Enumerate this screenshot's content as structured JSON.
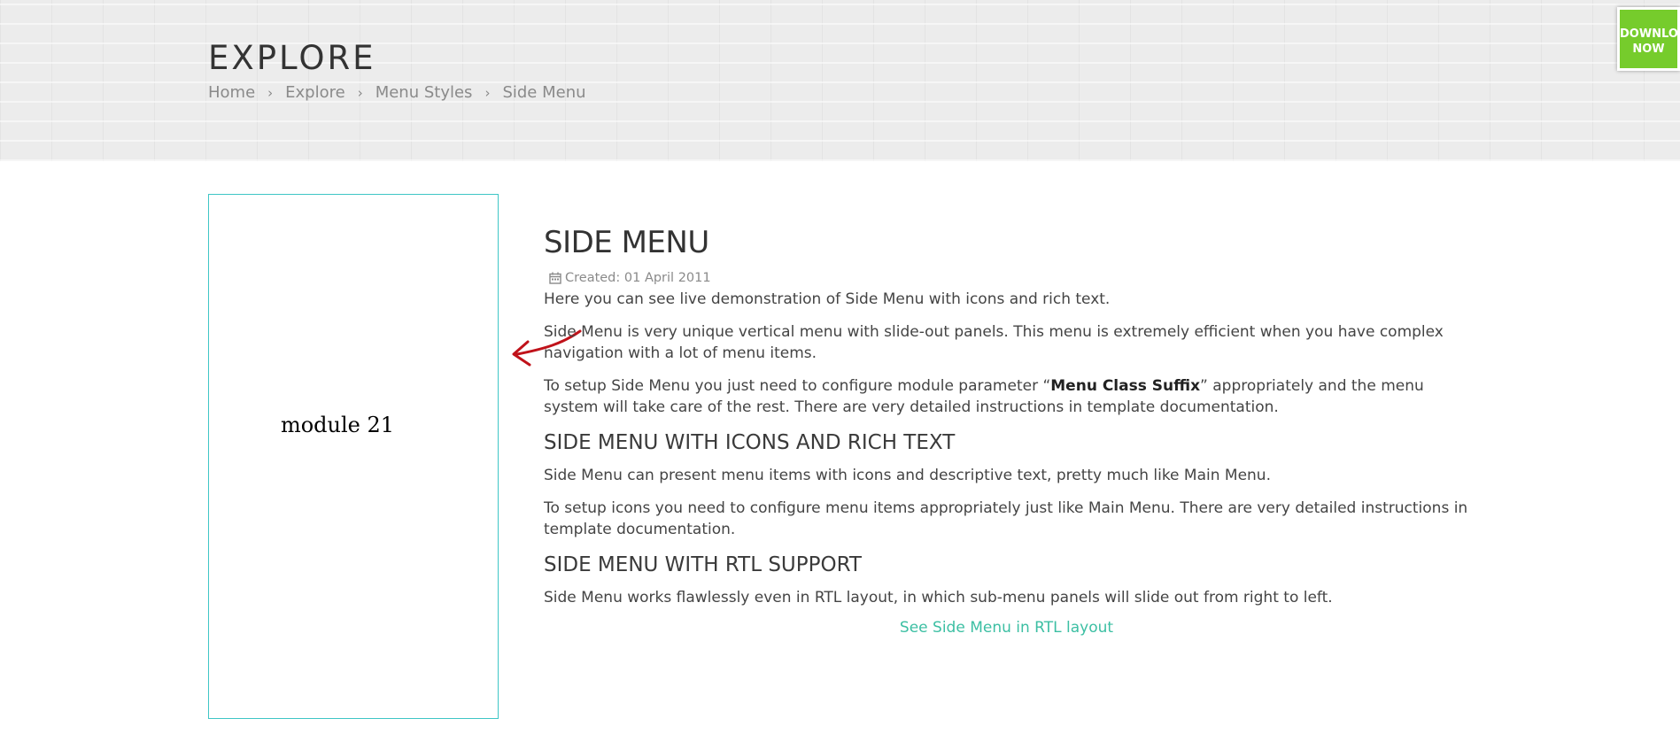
{
  "hero": {
    "title": "EXPLORE",
    "breadcrumb": [
      "Home",
      "Explore",
      "Menu Styles",
      "Side Menu"
    ],
    "separator_icon": "chevron-right-icon"
  },
  "download": {
    "line1": "DOWNLOAD",
    "line2": "NOW",
    "color": "#76cc2c"
  },
  "module": {
    "label": "module 21",
    "border_color": "#3fc6c6"
  },
  "article": {
    "title": "SIDE MENU",
    "created_icon": "calendar-icon",
    "created": "Created: 01 April 2011",
    "intro": "Here you can see live demonstration of Side Menu with icons and rich text.",
    "para1": "Side Menu is very unique vertical menu with slide-out panels. This menu is extremely efficient when you have complex navigation with a lot of menu items.",
    "para2_before": "To setup Side Menu you just need to configure module parameter “",
    "para2_bold": "Menu Class Suffix",
    "para2_after": "” appropriately and the menu system will take care of the rest. There are very detailed instructions in template documentation.",
    "section1_title": "SIDE MENU WITH ICONS AND RICH TEXT",
    "section1_p1": "Side Menu can present menu items with icons and descriptive text, pretty much like Main Menu.",
    "section1_p2": "To setup icons you need to configure menu items appropriately just like Main Menu. There are very detailed instructions in template documentation.",
    "section2_title": "SIDE MENU WITH RTL SUPPORT",
    "section2_p1": "Side Menu works flawlessly even in RTL layout, in which sub-menu panels will slide out from right to left.",
    "rtl_link": "See Side Menu in RTL layout",
    "link_color": "#3cbfa3"
  },
  "annotation": {
    "arrow_icon": "red-arrow-icon",
    "arrow_color": "#c0121a"
  }
}
